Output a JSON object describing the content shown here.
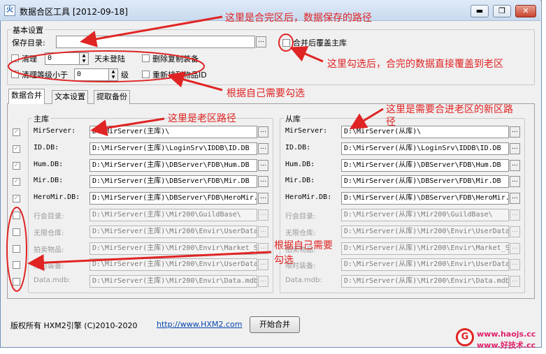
{
  "window": {
    "title": "数据合区工具 [2012-09-18]",
    "app_icon_glyph": "火"
  },
  "titlebar_buttons": {
    "minimize": "▬",
    "restore": "❐",
    "close": "✕"
  },
  "basic": {
    "group_title": "基本设置",
    "save_dir_label": "保存目录:",
    "save_dir_value": "",
    "browse_label": "…",
    "overwrite_label": "合并后覆盖主库",
    "clean_label": "清理",
    "clean_days_value": "0",
    "clean_days_suffix": "天未登陆",
    "remove_dup_label": "删除复制装备",
    "clean_level_label": "清理等级小于",
    "clean_level_value": "0",
    "clean_level_suffix": "级",
    "renumber_label": "重新排列物品ID"
  },
  "tabs": [
    "数据合并",
    "文本设置",
    "提取备份"
  ],
  "main_db": {
    "title": "主库",
    "rows": [
      {
        "label": "MirServer:",
        "value": "D:\\MirServer(主库)\\",
        "checked": "✓"
      },
      {
        "label": "ID.DB:",
        "value": "D:\\MirServer(主库)\\LoginSrv\\IDDB\\ID.DB",
        "checked": "✓"
      },
      {
        "label": "Hum.DB:",
        "value": "D:\\MirServer(主库)\\DBServer\\FDB\\Hum.DB",
        "checked": "✓"
      },
      {
        "label": "Mir.DB:",
        "value": "D:\\MirServer(主库)\\DBServer\\FDB\\Mir.DB",
        "checked": "✓"
      },
      {
        "label": "HeroMir.DB:",
        "value": "D:\\MirServer(主库)\\DBServer\\FDB\\HeroMir.",
        "checked": "✓"
      },
      {
        "label": "行会目录:",
        "value": "D:\\MirServer(主库)\\Mir200\\GuildBase\\",
        "checked": ""
      },
      {
        "label": "无限仓库:",
        "value": "D:\\MirServer(主库)\\Mir200\\Envir\\UserData",
        "checked": ""
      },
      {
        "label": "拍卖物品:",
        "value": "D:\\MirServer(主库)\\Mir200\\Envir\\Market_S",
        "checked": ""
      },
      {
        "label": "限时装备:",
        "value": "D:\\MirServer(主库)\\Mir200\\Envir\\UserData",
        "checked": ""
      },
      {
        "label": "Data.mdb:",
        "value": "D:\\MirServer(主库)\\Mir200\\Envir\\Data.mdb",
        "checked": ""
      }
    ]
  },
  "slave_db": {
    "title": "从库",
    "rows": [
      {
        "label": "MirServer:",
        "value": "D:\\MirServer(从库)\\"
      },
      {
        "label": "ID.DB:",
        "value": "D:\\MirServer(从库)\\LoginSrv\\IDDB\\ID.DB"
      },
      {
        "label": "Hum.DB:",
        "value": "D:\\MirServer(从库)\\DBServer\\FDB\\Hum.DB"
      },
      {
        "label": "Mir.DB:",
        "value": "D:\\MirServer(从库)\\DBServer\\FDB\\Mir.DB"
      },
      {
        "label": "HeroMir.DB:",
        "value": "D:\\MirServer(从库)\\DBServer\\FDB\\HeroMir."
      },
      {
        "label": "行会目录:",
        "value": "D:\\MirServer(从库)\\Mir200\\GuildBase\\"
      },
      {
        "label": "无限仓库:",
        "value": "D:\\MirServer(从库)\\Mir200\\Envir\\UserData"
      },
      {
        "label": "拍卖物品:",
        "value": "D:\\MirServer(从库)\\Mir200\\Envir\\Market_S"
      },
      {
        "label": "限时装备:",
        "value": "D:\\MirServer(从库)\\Mir200\\Envir\\UserData"
      },
      {
        "label": "Data.mdb:",
        "value": "D:\\MirServer(从库)\\Mir200\\Envir\\Data.mdb"
      }
    ]
  },
  "footer": {
    "copyright": "版权所有 HXM2引擎 (C)2010-2020",
    "link": "http://www.HXM2.com",
    "start_button": "开始合并"
  },
  "annotations": {
    "save_path": "这里是合完区后，数据保存的路径",
    "overwrite": "这里勾选后，合完的数据直接覆盖到老区",
    "options": "根据自己需要勾选",
    "old_path": "这里是老区路径",
    "new_path_1": "这里是需要合进老区的新区路",
    "new_path_2": "径",
    "check_1": "根据自己需要",
    "check_2": "勾选",
    "color": "#e02424"
  },
  "watermark": {
    "line1": "www.haojs.cc",
    "line2": "www.好技术.cc",
    "color": "#e0206a"
  }
}
